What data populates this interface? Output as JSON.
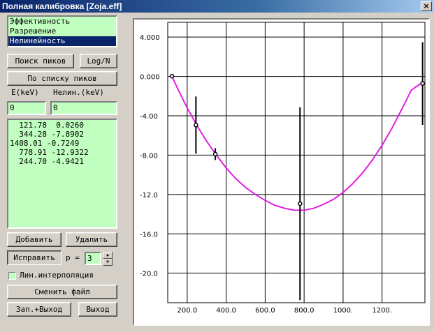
{
  "window": {
    "title": "Полная калибровка [Zoja.eff]",
    "close_label": "×"
  },
  "modes": [
    {
      "label": "Эффективность",
      "selected": false
    },
    {
      "label": "Разрешение",
      "selected": false
    },
    {
      "label": "Нелинейность",
      "selected": true
    }
  ],
  "buttons": {
    "peak_search": "Поиск пиков",
    "log_n": "Log/N",
    "by_peak_list": "По списку пиков",
    "add": "Добавить",
    "delete": "Удалить",
    "fix": "Исправить",
    "change_file": "Сменить файл",
    "save_exit": "Зап.+Выход",
    "exit": "Выход"
  },
  "columns": {
    "energy": "E(keV)",
    "nonlin": "Нелин.(keV)"
  },
  "inputs": {
    "energy_value": "0",
    "nonlin_value": "0"
  },
  "data_rows": [
    "  121.78  0.0260",
    "  344.28 -7.8902",
    "1408.01 -0.7249",
    "  778.91 -12.9322",
    "  244.70 -4.9421"
  ],
  "poly": {
    "label": "p =",
    "value": "3"
  },
  "interp": {
    "label": "Лин.интерполяция",
    "checked": false
  },
  "colors": {
    "curve": "#e020e0",
    "list_bg": "#c0ffc0",
    "selection": "#0a246a"
  },
  "chart_data": {
    "type": "scatter",
    "xlim": [
      100,
      1420
    ],
    "ylim": [
      -23,
      5.5
    ],
    "x_ticks": [
      {
        "value": 200,
        "label": "200.0"
      },
      {
        "value": 400,
        "label": "400.0"
      },
      {
        "value": 600,
        "label": "600.0"
      },
      {
        "value": 800,
        "label": "800.0"
      },
      {
        "value": 1000,
        "label": "1000."
      },
      {
        "value": 1200,
        "label": "1200."
      }
    ],
    "y_ticks": [
      {
        "value": 4,
        "label": "4.000"
      },
      {
        "value": 0,
        "label": "0.000"
      },
      {
        "value": -4,
        "label": "-4.00"
      },
      {
        "value": -8,
        "label": "-8.00"
      },
      {
        "value": -12,
        "label": "-12.0"
      },
      {
        "value": -16,
        "label": "-16.0"
      },
      {
        "value": -20,
        "label": "-20.0"
      }
    ],
    "grid": true,
    "points": [
      {
        "x": 121.78,
        "y": 0.026,
        "err": 0.1
      },
      {
        "x": 244.7,
        "y": -4.9421,
        "err": 2.9
      },
      {
        "x": 344.28,
        "y": -7.8902,
        "err": 0.6
      },
      {
        "x": 778.91,
        "y": -12.9322,
        "err": 9.8
      },
      {
        "x": 1408.01,
        "y": -0.7249,
        "err": 4.2
      }
    ],
    "fit_curve": [
      [
        121.78,
        0.0
      ],
      [
        150,
        -1.2
      ],
      [
        200,
        -3.2
      ],
      [
        250,
        -5.0
      ],
      [
        300,
        -6.6
      ],
      [
        350,
        -8.0
      ],
      [
        400,
        -9.3
      ],
      [
        450,
        -10.4
      ],
      [
        500,
        -11.3
      ],
      [
        550,
        -12.0
      ],
      [
        600,
        -12.6
      ],
      [
        650,
        -13.1
      ],
      [
        700,
        -13.4
      ],
      [
        750,
        -13.6
      ],
      [
        800,
        -13.6
      ],
      [
        850,
        -13.4
      ],
      [
        900,
        -13.0
      ],
      [
        950,
        -12.5
      ],
      [
        1000,
        -11.8
      ],
      [
        1050,
        -10.9
      ],
      [
        1100,
        -9.8
      ],
      [
        1150,
        -8.5
      ],
      [
        1200,
        -7.0
      ],
      [
        1250,
        -5.3
      ],
      [
        1300,
        -3.4
      ],
      [
        1350,
        -1.4
      ],
      [
        1408.01,
        -0.6
      ]
    ]
  }
}
